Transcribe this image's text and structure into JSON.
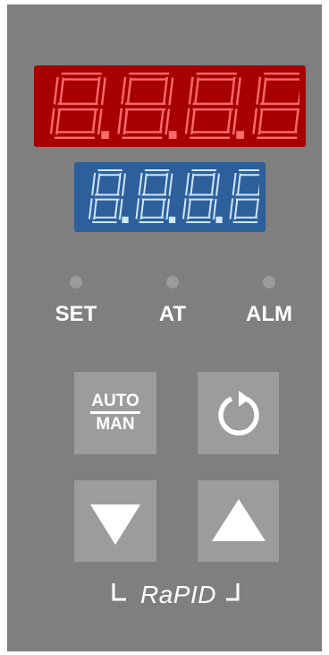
{
  "display_top": {
    "digits": 4,
    "segments": "all-on",
    "color": "#a60000",
    "segment_color": "#ff6a6a"
  },
  "display_bottom": {
    "digits": 4,
    "segments": "all-on",
    "color": "#2d5f9a",
    "segment_color": "#cfe6ff"
  },
  "indicators": [
    {
      "label": "SET",
      "led": "off"
    },
    {
      "label": "AT",
      "led": "off"
    },
    {
      "label": "ALM",
      "led": "off"
    }
  ],
  "buttons": {
    "auto_man_top": "AUTO",
    "auto_man_bottom": "MAN",
    "cycle_icon": "rotate-arrow-icon",
    "down_icon": "triangle-down-icon",
    "up_icon": "triangle-up-icon"
  },
  "brand": "RaPID",
  "colors": {
    "panel": "#7f7f7f",
    "button": "#9c9c9c",
    "text": "#ffffff"
  }
}
